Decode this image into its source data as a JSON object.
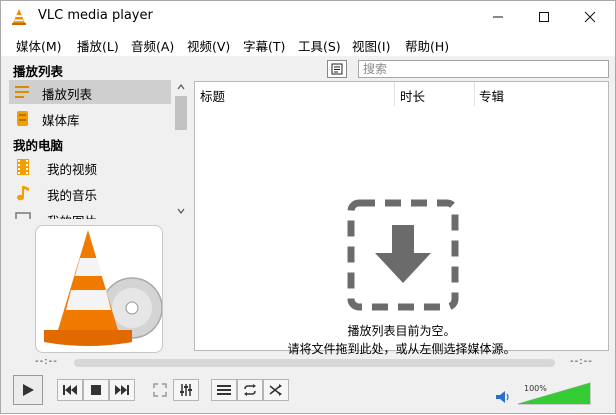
{
  "window": {
    "title": "VLC media player",
    "controls": [
      "minimize",
      "maximize",
      "close"
    ]
  },
  "menu": [
    "媒体(M)",
    "播放(L)",
    "音频(A)",
    "视频(V)",
    "字幕(T)",
    "工具(S)",
    "视图(I)",
    "帮助(H)"
  ],
  "sidebar": {
    "sections": [
      {
        "title": "播放列表"
      },
      {
        "title": "我的电脑"
      }
    ],
    "items": [
      {
        "label": "播放列表",
        "icon": "playlist-icon",
        "selected": true
      },
      {
        "label": "媒体库",
        "icon": "media-library-icon"
      },
      {
        "label": "我的视频",
        "icon": "film-icon"
      },
      {
        "label": "我的音乐",
        "icon": "music-note-icon"
      },
      {
        "label": "我的图片",
        "icon": "picture-icon"
      }
    ]
  },
  "playlist": {
    "search_placeholder": "搜索",
    "columns": [
      "标题",
      "时长",
      "专辑"
    ],
    "empty_line1": "播放列表目前为空。",
    "empty_line2": "请将文件拖到此处，或从左侧选择媒体源。"
  },
  "player": {
    "time_elapsed": "--:--",
    "time_total": "--:--",
    "volume_percent": "100%",
    "volume_level": 1.0
  },
  "colors": {
    "vlc_orange": "#f08a00",
    "volume_green": "#33cc33",
    "drop_icon": "#6b6b6b"
  }
}
